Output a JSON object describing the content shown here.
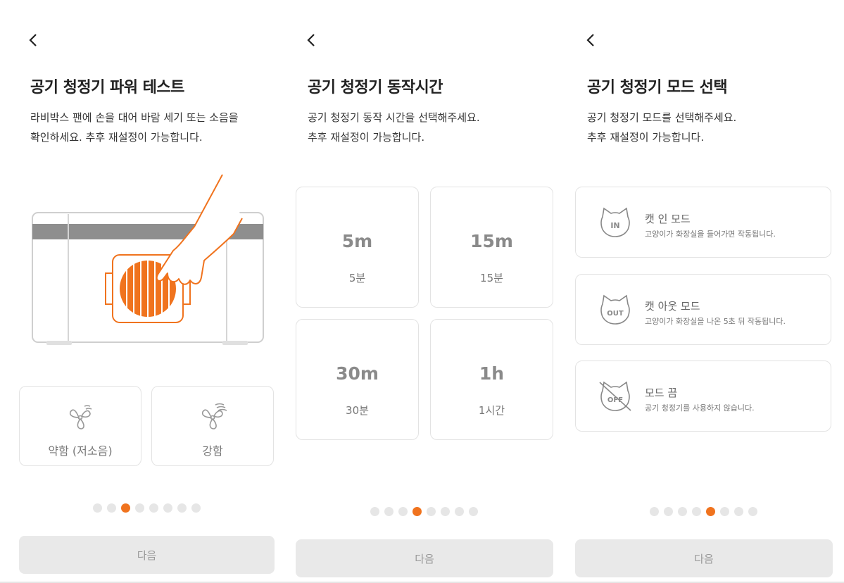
{
  "power_test": {
    "title": "공기 청정기 파워 테스트",
    "desc_line1": "라비박스 팬에 손을 대어 바람 세기 또는 소음을",
    "desc_line2": "확인하세요. 추후 재설정이 가능합니다.",
    "options": [
      {
        "label": "약함 (저소음)",
        "icon": "fan-weak-icon"
      },
      {
        "label": "강함",
        "icon": "fan-strong-icon"
      }
    ],
    "page_indicator": {
      "total": 8,
      "active": 3
    },
    "next_label": "다음",
    "accent_color": "#f0731e"
  },
  "duration": {
    "title": "공기 청정기 동작시간",
    "desc_line1": "공기 청정기 동작 시간을 선택해주세요.",
    "desc_line2": "추후 재설정이 가능합니다.",
    "options": [
      {
        "value": "5m",
        "label": "5분"
      },
      {
        "value": "15m",
        "label": "15분"
      },
      {
        "value": "30m",
        "label": "30분"
      },
      {
        "value": "1h",
        "label": "1시간"
      }
    ],
    "page_indicator": {
      "total": 8,
      "active": 4
    },
    "next_label": "다음"
  },
  "mode": {
    "title": "공기 청정기 모드 선택",
    "desc_line1": "공기 청정기 모드를 선택해주세요.",
    "desc_line2": "추후 재설정이 가능합니다.",
    "options": [
      {
        "badge": "IN",
        "name": "캣 인 모드",
        "desc": "고양이가 화장실을 들어가면 작동됩니다.",
        "icon": "cat-in-icon"
      },
      {
        "badge": "OUT",
        "name": "캣 아웃 모드",
        "desc": "고양이가 화장실을 나온 5초 뒤 작동됩니다.",
        "icon": "cat-out-icon"
      },
      {
        "badge": "OFF",
        "name": "모드 끔",
        "desc": "공기 청정기를 사용하지 않습니다.",
        "icon": "cat-off-icon"
      }
    ],
    "page_indicator": {
      "total": 8,
      "active": 5
    },
    "next_label": "다음"
  }
}
